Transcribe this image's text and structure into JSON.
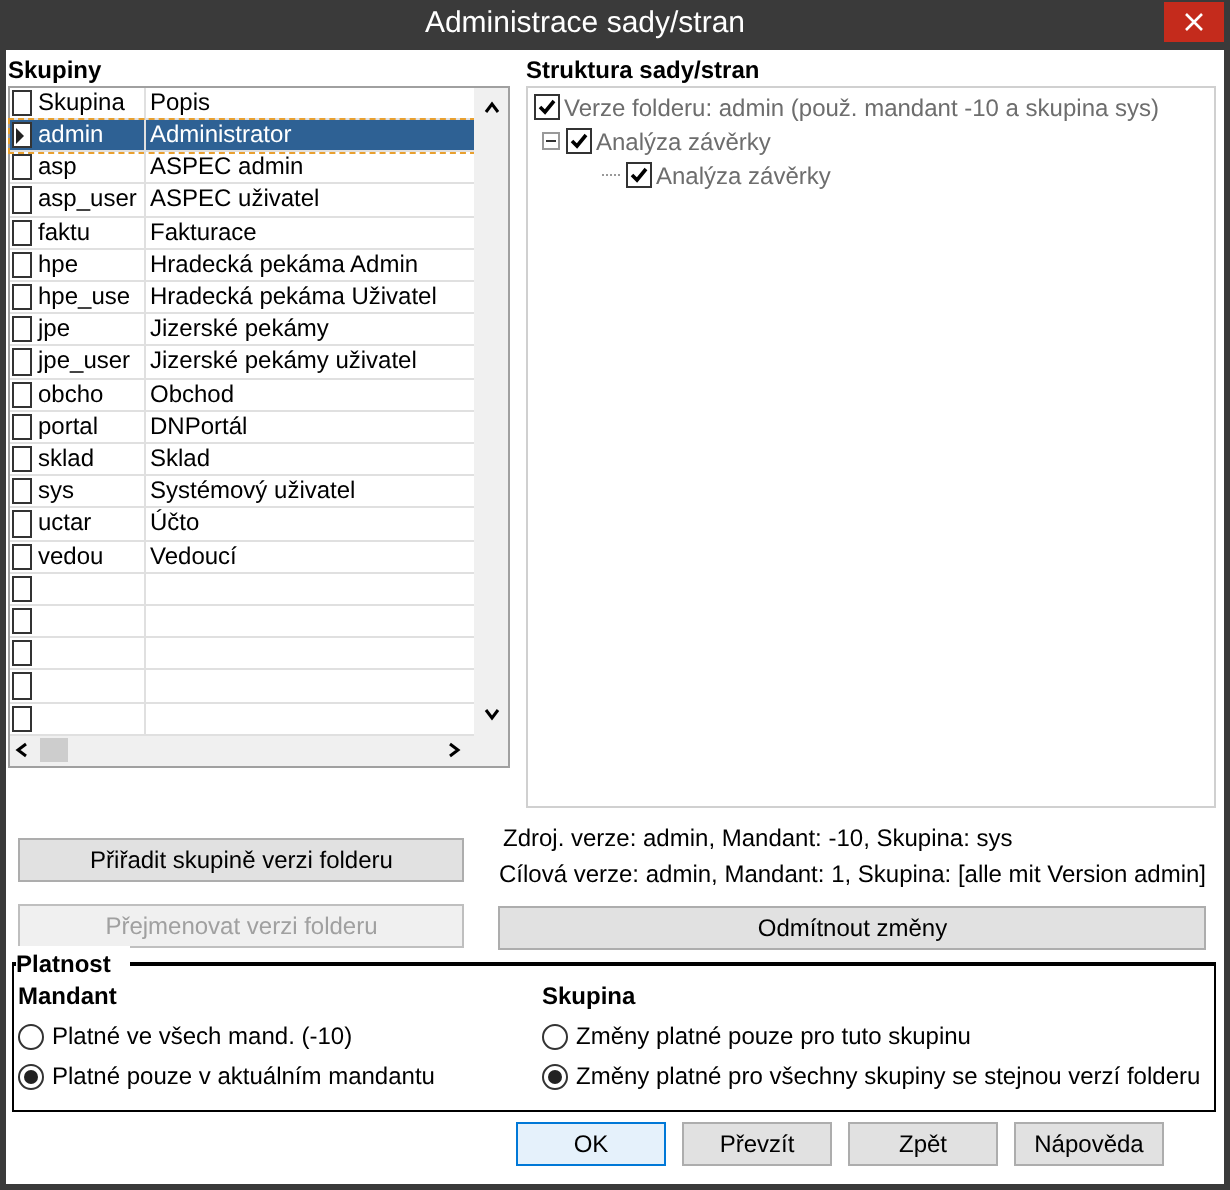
{
  "window": {
    "title": "Administrace sady/stran"
  },
  "groups": {
    "title": "Skupiny",
    "columns": [
      "Skupina",
      "Popis"
    ],
    "rows": [
      {
        "group": "admin",
        "description": "Administrator",
        "selected": true
      },
      {
        "group": "asp",
        "description": "ASPEC admin",
        "selected": false
      },
      {
        "group": "asp_user",
        "description": "ASPEC uživatel",
        "selected": false
      },
      {
        "group": "faktu",
        "description": "Fakturace",
        "selected": false
      },
      {
        "group": "hpe",
        "description": "Hradecká pekáma Admin",
        "selected": false
      },
      {
        "group": "hpe_use",
        "description": "Hradecká pekáma Uživatel",
        "selected": false
      },
      {
        "group": "jpe",
        "description": "Jizerské pekámy",
        "selected": false
      },
      {
        "group": "jpe_user",
        "description": "Jizerské pekámy uživatel",
        "selected": false
      },
      {
        "group": "obcho",
        "description": "Obchod",
        "selected": false
      },
      {
        "group": "portal",
        "description": "DNPortál",
        "selected": false
      },
      {
        "group": "sklad",
        "description": "Sklad",
        "selected": false
      },
      {
        "group": "sys",
        "description": "Systémový uživatel",
        "selected": false
      },
      {
        "group": "uctar",
        "description": "Účto",
        "selected": false
      },
      {
        "group": "vedou",
        "description": "Vedoucí",
        "selected": false
      }
    ]
  },
  "structure": {
    "title": "Struktura sady/stran",
    "tree": [
      {
        "label": "Verze folderu: admin (použ. mandant -10 a skupina sys)",
        "checked": true,
        "children": [
          {
            "label": "Analýza závěrky",
            "checked": true,
            "expanded": true,
            "children": [
              {
                "label": "Analýza závěrky",
                "checked": true,
                "expanded": false
              }
            ]
          }
        ]
      }
    ]
  },
  "left_buttons": [
    {
      "label": "Přiřadit skupině verzi folderu",
      "disabled": false
    },
    {
      "label": "Přejmenovat verzi folderu",
      "disabled": true
    }
  ],
  "info": [
    "Zdroj. verze: admin, Mandant: -10, Skupina: sys",
    "Cílová verze: admin, Mandant: 1, Skupina: [alle mit Version admin]"
  ],
  "reject_button": {
    "label": "Odmítnout změny",
    "disabled": false
  },
  "validity": {
    "title": "Platnost",
    "mandant": {
      "title": "Mandant",
      "options": [
        {
          "label": "Platné ve všech mand. (-10)",
          "selected": false
        },
        {
          "label": "Platné pouze v aktuálním mandantu",
          "selected": true
        }
      ]
    },
    "group": {
      "title": "Skupina",
      "options": [
        {
          "label": "Změny platné pouze pro tuto skupinu",
          "selected": false
        },
        {
          "label": "Změny platné pro všechny skupiny  se stejnou verzí folderu",
          "selected": true
        }
      ]
    }
  },
  "buttons": [
    {
      "label": "OK",
      "focused": true
    },
    {
      "label": "Převzít",
      "focused": false
    },
    {
      "label": "Zpět",
      "focused": false
    },
    {
      "label": "Nápověda",
      "focused": false
    }
  ]
}
